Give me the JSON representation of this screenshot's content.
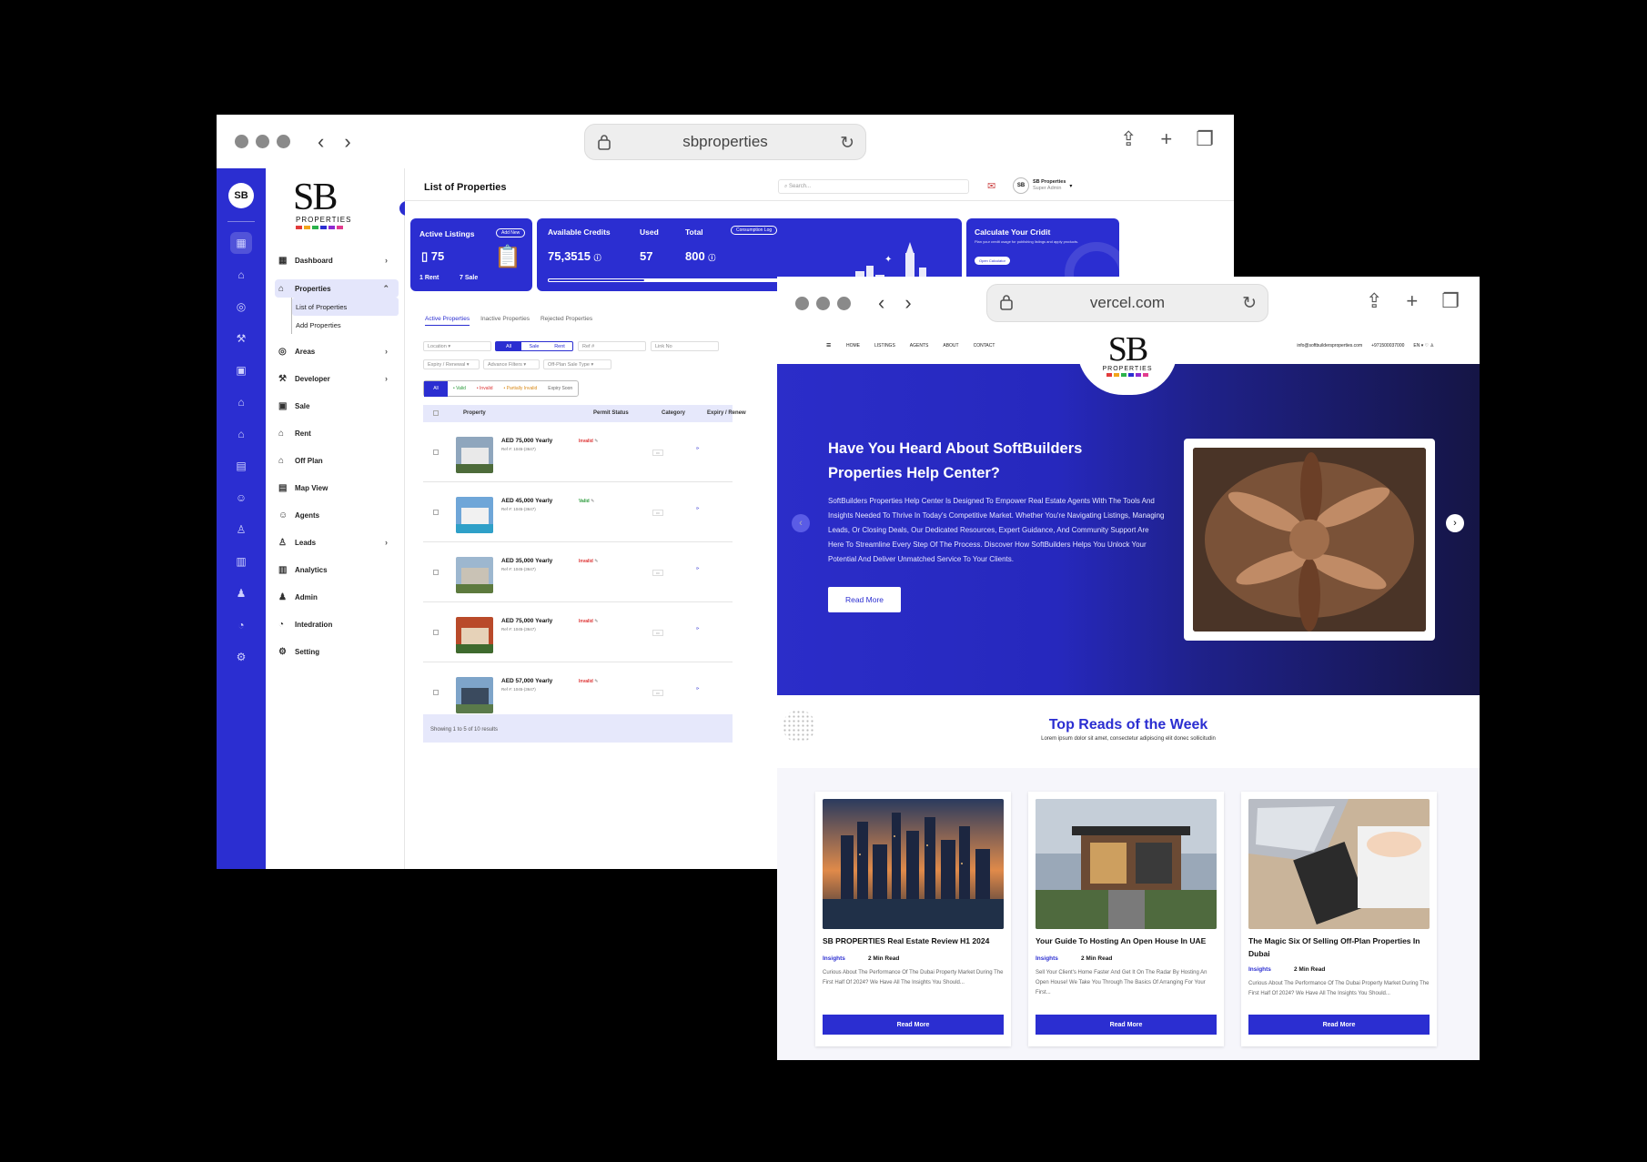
{
  "admin_window": {
    "url": "sbproperties",
    "logo": {
      "mark": "SB",
      "sub": "PROPERTIES",
      "mini": "SB"
    },
    "sidebar": {
      "items": [
        {
          "label": "Dashboard",
          "icon": "grid-icon",
          "chevron": "›"
        },
        {
          "label": "Properties",
          "icon": "building-icon",
          "chevron": "⌃"
        },
        {
          "label": "Areas",
          "icon": "search-area-icon",
          "chevron": "›"
        },
        {
          "label": "Developer",
          "icon": "developer-icon",
          "chevron": "›"
        },
        {
          "label": "Sale",
          "icon": "sale-icon"
        },
        {
          "label": "Rent",
          "icon": "rent-icon"
        },
        {
          "label": "Off Plan",
          "icon": "off-plan-icon"
        },
        {
          "label": "Map View",
          "icon": "map-icon"
        },
        {
          "label": "Agents",
          "icon": "agent-icon"
        },
        {
          "label": "Leads",
          "icon": "leads-icon",
          "chevron": "›"
        },
        {
          "label": "Analytics",
          "icon": "analytics-icon"
        },
        {
          "label": "Admin",
          "icon": "admin-icon"
        },
        {
          "label": "Intedration",
          "icon": "integration-icon"
        },
        {
          "label": "Setting",
          "icon": "gear-icon"
        }
      ],
      "sub_items": [
        "List of Properties",
        "Add Properties"
      ]
    },
    "header": {
      "title": "List of Properties",
      "search_placeholder": "Search...",
      "user_name": "SB Properties",
      "user_role": "Super Admin"
    },
    "cards": {
      "active_listings": {
        "label": "Active Listings",
        "badge": "Add New",
        "value": "75",
        "rent": "1 Rent",
        "sale": "7 Sale"
      },
      "credits": {
        "label": "Available Credits",
        "value": "75,3515",
        "used_label": "Used",
        "used": "57",
        "total_label": "Total",
        "total": "800",
        "badge": "Consumption Log",
        "progress": 0.37
      },
      "calculate": {
        "label": "Calculate Your Cridit",
        "desc": "Plan your credit usage for publishing listings and apply products.",
        "button": "Open Calculator"
      }
    },
    "tabs": [
      "Active Properties",
      "Inactive Properties",
      "Rejected Properties"
    ],
    "filters": {
      "location": "Location",
      "type_all": "All",
      "type_sale": "Sale",
      "type_rent": "Rent",
      "ref": "Ref #",
      "link": "Link No",
      "expiry": "Expiry / Renewal",
      "advance": "Advance Filters",
      "offplan": "Off-Plan Sale Type"
    },
    "status_filter": [
      "All",
      "• Valid",
      "• Invalid",
      "• Partially Invalid",
      "Expiry Soon"
    ],
    "table": {
      "columns": [
        "Property",
        "Permit Status",
        "Category",
        "Expiry / Renew"
      ],
      "rows": [
        {
          "price": "AED 75,000 Yearly",
          "status": "Invalid",
          "status_color": "#d33",
          "meta": "Ref #: 1045-(3647)"
        },
        {
          "price": "AED 45,000 Yearly",
          "status": "Valid",
          "status_color": "#2a9a3a",
          "meta": "Ref #: 1045-(3647)"
        },
        {
          "price": "AED 35,000 Yearly",
          "status": "Invalid",
          "status_color": "#d33",
          "meta": "Ref #: 1045-(3647)"
        },
        {
          "price": "AED 75,000 Yearly",
          "status": "Invalid",
          "status_color": "#d33",
          "meta": "Ref #: 1045-(3647)"
        },
        {
          "price": "AED 57,000 Yearly",
          "status": "Invalid",
          "status_color": "#d33",
          "meta": "Ref #: 1045-(3647)"
        }
      ],
      "footer": "Showing 1 to 5 of 10 results"
    }
  },
  "site_window": {
    "url": "vercel.com",
    "nav_links": [
      "HOME",
      "LISTINGS",
      "AGENTS",
      "ABOUT",
      "CONTACT"
    ],
    "contact": [
      "info@softbuildersproperties.com",
      "+971500037000"
    ],
    "logo": {
      "mark": "SB",
      "sub": "PROPERTIES"
    },
    "hero": {
      "title": "Have You Heard About SoftBuilders Properties Help Center?",
      "body": "SoftBuilders Properties Help Center Is Designed To Empower Real Estate Agents With The Tools And Insights Needed To Thrive In Today's Competitive Market. Whether You're Navigating Listings, Managing Leads, Or Closing Deals, Our Dedicated Resources, Expert Guidance, And Community Support Are Here To Streamline Every Step Of The Process. Discover How SoftBuilders Helps You Unlock Your Potential And Deliver Unmatched Service To Your Clients.",
      "button": "Read More"
    },
    "reads": {
      "title": "Top Reads of the Week",
      "subtitle": "Lorem ipsum dolor sit amet, consectetur adipiscing elit donec sollicitudin",
      "articles": [
        {
          "title": "SB PROPERTIES Real Estate Review H1 2024",
          "tag": "Insights",
          "read": "2 Min Read",
          "desc": "Curious About The Performance Of The Dubai Property Market During The First Half Of 2024? We Have All The Insights You Should...",
          "button": "Read More"
        },
        {
          "title": "Your Guide To Hosting An Open House In UAE",
          "tag": "Insights",
          "read": "2 Min Read",
          "desc": "Sell Your Client's Home Faster And Get It On The Radar By Hosting An Open House! We Take You Through The Basics Of Arranging For Your First...",
          "button": "Read More"
        },
        {
          "title": "The Magic Six Of Selling Off-Plan Properties In Dubai",
          "tag": "Insights",
          "read": "2 Min Read",
          "desc": "Curious About The Performance Of The Dubai Property Market During The First Half Of 2024? We Have All The Insights You Should...",
          "button": "Read More"
        }
      ]
    }
  },
  "colors": {
    "brand": "#2b2ed1",
    "logo_bars": [
      "#e23b3b",
      "#f2a51a",
      "#2bb24c",
      "#2b2ed1",
      "#8e2bd1",
      "#e23b8e"
    ]
  }
}
